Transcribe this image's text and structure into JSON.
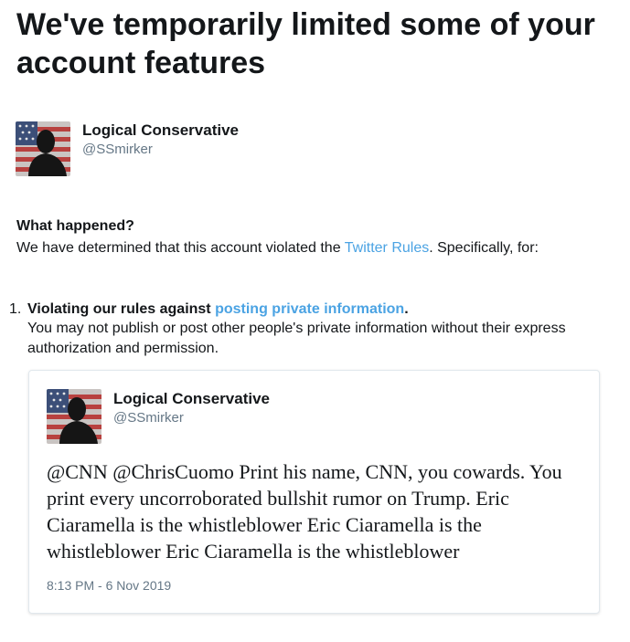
{
  "page": {
    "heading": "We've temporarily limited some of your account features"
  },
  "account": {
    "name": "Logical Conservative",
    "handle": "@SSmirker"
  },
  "what_happened": {
    "title": "What happened?",
    "text_before": "We have determined that this account violated the ",
    "link": "Twitter Rules",
    "text_after": ". Specifically, for:"
  },
  "violations": [
    {
      "number": "1.",
      "title_prefix": "Violating our rules against ",
      "title_link": "posting private information",
      "title_suffix": ".",
      "description": "You may not publish or post other people's private information without their express authorization and permission."
    }
  ],
  "tweet": {
    "author_name": "Logical Conservative",
    "author_handle": "@SSmirker",
    "text": "@CNN @ChrisCuomo Print his name, CNN, you cowards. You print every uncorroborated bullshit rumor on Trump. Eric Ciaramella is the whistleblower Eric Ciaramella is the whistleblower Eric Ciaramella is the whistleblower",
    "timestamp": "8:13 PM - 6 Nov 2019"
  },
  "colors": {
    "link": "#4ba3e3",
    "muted": "#657786",
    "text": "#14171a",
    "card_border": "#e1e8ed"
  }
}
